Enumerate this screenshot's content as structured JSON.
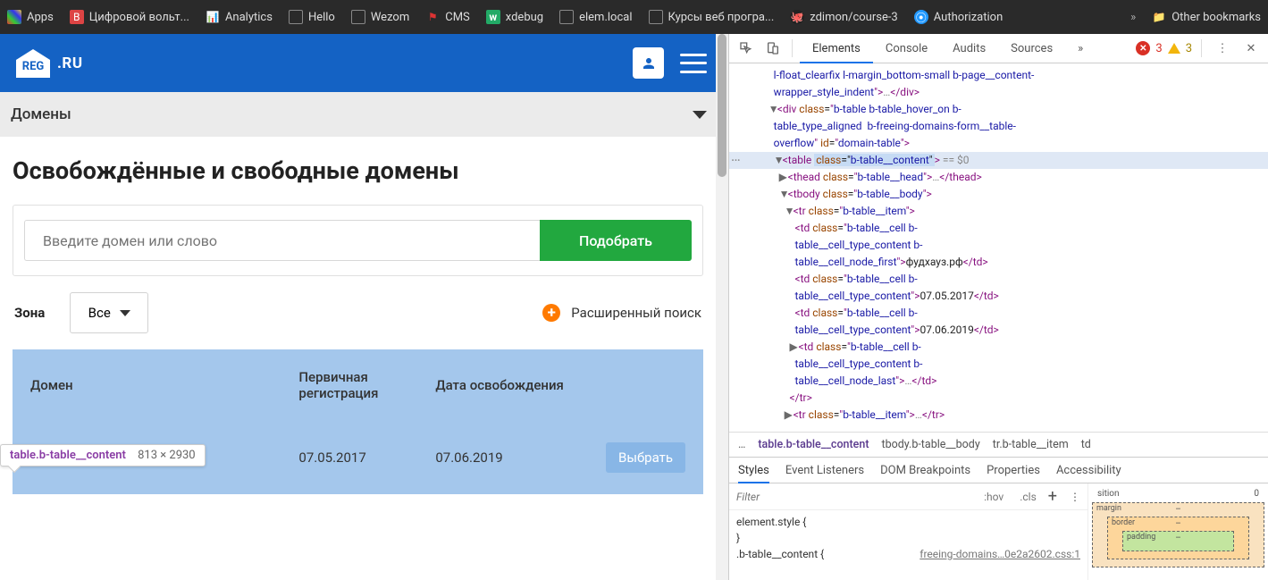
{
  "bookmarks": {
    "items": [
      {
        "label": "Apps",
        "icon": "grid",
        "color": ""
      },
      {
        "label": "Цифровой вольт...",
        "icon": "doc",
        "color": "#d44"
      },
      {
        "label": "Analytics",
        "icon": "bars",
        "color": "#f90"
      },
      {
        "label": "Hello",
        "icon": "page",
        "color": ""
      },
      {
        "label": "Wezom",
        "icon": "page",
        "color": ""
      },
      {
        "label": "CMS",
        "icon": "flag",
        "color": "#d33"
      },
      {
        "label": "xdebug",
        "icon": "w",
        "color": "#39c"
      },
      {
        "label": "elem.local",
        "icon": "page",
        "color": ""
      },
      {
        "label": "Курсы веб програ...",
        "icon": "page",
        "color": ""
      },
      {
        "label": "zdimon/course-3",
        "icon": "gh",
        "color": ""
      },
      {
        "label": "Authorization",
        "icon": "auth",
        "color": "#29f"
      }
    ],
    "other": "Other bookmarks"
  },
  "site": {
    "logo_text": "REG",
    "logo_sub": ".RU",
    "collapse_title": "Домены",
    "h1": "Освобождённые и свободные домены",
    "search_placeholder": "Введите домен или слово",
    "search_btn": "Подобрать",
    "zone_label": "Зона",
    "zone_value": "Все",
    "advanced": "Расширенный поиск"
  },
  "tooltip": {
    "selector": "table.b-table__content",
    "dims": "813 × 2930"
  },
  "table": {
    "headers": [
      "Домен",
      "Первичная регистрация",
      "Дата освобождения",
      ""
    ],
    "rows": [
      {
        "domain": "фудхауз.рф",
        "reg": "07.05.2017",
        "free": "07.06.2019",
        "btn": "Выбрать"
      }
    ]
  },
  "devtools": {
    "tabs": [
      "Elements",
      "Console",
      "Audits",
      "Sources"
    ],
    "more": "»",
    "errors": "3",
    "warnings": "3",
    "crumbs": [
      "…",
      "table.b-table__content",
      "tbody.b-table__body",
      "tr.b-table__item",
      "td"
    ],
    "styles_tabs": [
      "Styles",
      "Event Listeners",
      "DOM Breakpoints",
      "Properties",
      "Accessibility"
    ],
    "filter_ph": "Filter",
    "hov": ":hov",
    "cls": ".cls",
    "element_style": "element.style {",
    "brace": "}",
    "rule_sel": ".b-table__content",
    "rule_link": "freeing-domains…0e2a2602.css:1",
    "box": {
      "position_label": "sition",
      "position_val": "0",
      "margin_label": "margin",
      "border_label": "border",
      "padding_label": "padding",
      "dash": "–"
    },
    "dom": {
      "line1a": "l-float_clearfix l-margin_bottom-small b-page__content-",
      "line1b": "wrapper_style_indent",
      "line2a": "b-table b-table_hover_on b-",
      "line2b": "table_type_aligned  b-freeing-domains-form__table-",
      "line2c": "overflow",
      "line2d": "domain-table",
      "line3": "b-table__content",
      "line3eq": " == $0",
      "line4": "b-table__head",
      "line5": "b-table__body",
      "line6": "b-table__item",
      "line7a": "b-table__cell b-",
      "line7b": "table__cell_type_content b-",
      "line7c": "table__cell_node_first",
      "line7txt": "фудхауз.рф",
      "line8a": "b-table__cell b-",
      "line8b": "table__cell_type_content",
      "line8txt": "07.05.2017",
      "line9txt": "07.06.2019",
      "line10c": "table__cell_node_last"
    }
  }
}
